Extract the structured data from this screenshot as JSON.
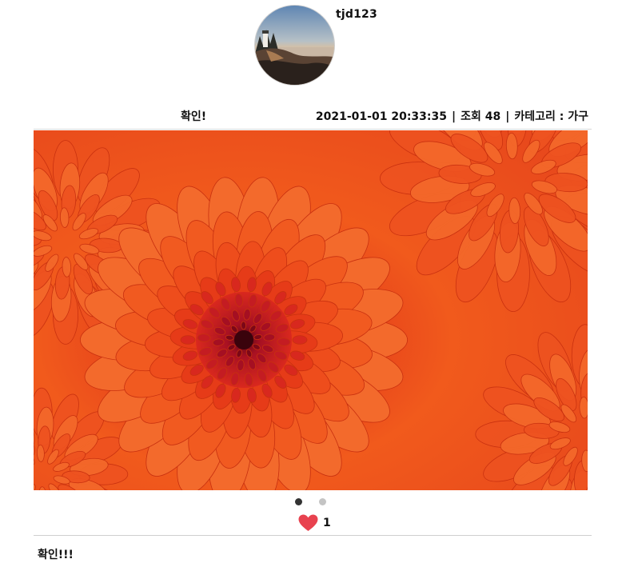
{
  "author": {
    "username": "tjd123",
    "avatar_icon": "lighthouse-landscape-avatar"
  },
  "post": {
    "title": "확인!",
    "datetime": "2021-01-01 20:33:35",
    "separator": "|",
    "views_label": "조회 48",
    "category_label": "카테고리 : 가구",
    "image_subject": "orange-chrysanthemum-photo",
    "body": "확인!!!"
  },
  "carousel": {
    "total": 2,
    "active_index": 0,
    "active_color": "#333333",
    "inactive_color": "#c4c4c4"
  },
  "likes": {
    "count": "1",
    "icon": "heart-icon",
    "color": "#e8424f"
  }
}
